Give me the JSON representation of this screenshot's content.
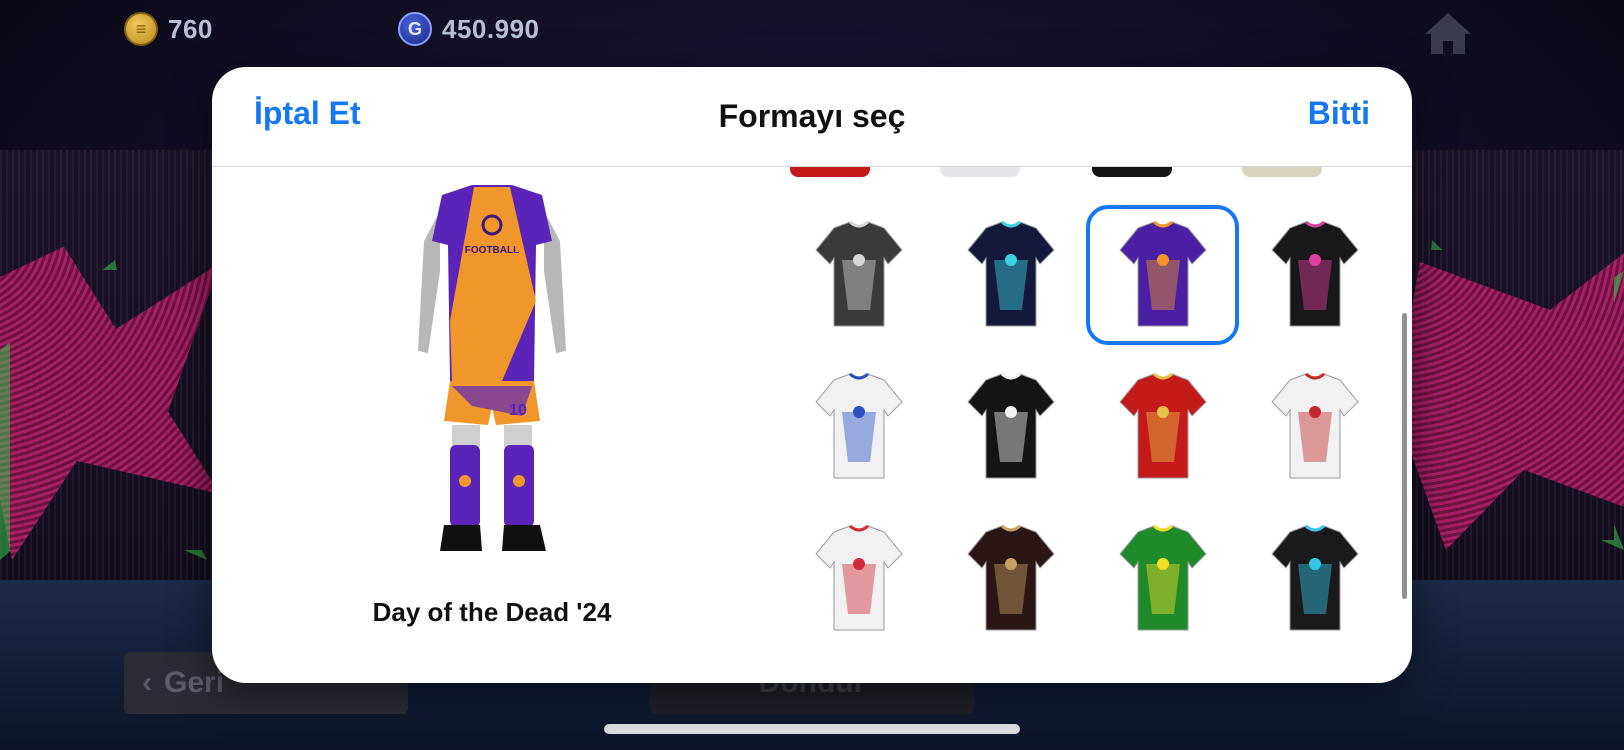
{
  "currency": {
    "coins": "760",
    "gp": "450.990",
    "coin_icon": "efootball-coin-icon",
    "gp_icon": "gp-icon"
  },
  "background": {
    "back_label": "Geri",
    "rotate_label": "Döndür"
  },
  "modal": {
    "cancel_label": "İptal Et",
    "title": "Formayı seç",
    "done_label": "Bitti",
    "selected_kit_name": "Day of the Dead '24"
  },
  "kits": [
    {
      "id": "kit-black-magenta-t",
      "color": "#3a3a3c",
      "accent": "#d6d6d6"
    },
    {
      "id": "kit-navy-cyan-purple",
      "color": "#14183a",
      "accent": "#3ad2e0"
    },
    {
      "id": "kit-day-of-the-dead",
      "color": "#4b1fa3",
      "accent": "#f0962a"
    },
    {
      "id": "kit-black-colorful",
      "color": "#18181a",
      "accent": "#e0409c"
    },
    {
      "id": "kit-white-blue-collar",
      "color": "#f1f1f3",
      "accent": "#2a4fc0"
    },
    {
      "id": "kit-black-white-kanji",
      "color": "#141416",
      "accent": "#f2f2f2"
    },
    {
      "id": "kit-red-gold",
      "color": "#c41a1a",
      "accent": "#e8c24a"
    },
    {
      "id": "kit-white-red-kanji",
      "color": "#f1f1f3",
      "accent": "#c42a2a"
    },
    {
      "id": "kit-white-red-blue-sleeves",
      "color": "#f1f1f3",
      "accent": "#d22a3a"
    },
    {
      "id": "kit-black-gold-stripes",
      "color": "#2a1614",
      "accent": "#c9a064"
    },
    {
      "id": "kit-green-yellow",
      "color": "#1f8a2a",
      "accent": "#f2dd2a"
    },
    {
      "id": "kit-black-cyan-orange",
      "color": "#1a1a1c",
      "accent": "#34c6e6"
    }
  ]
}
